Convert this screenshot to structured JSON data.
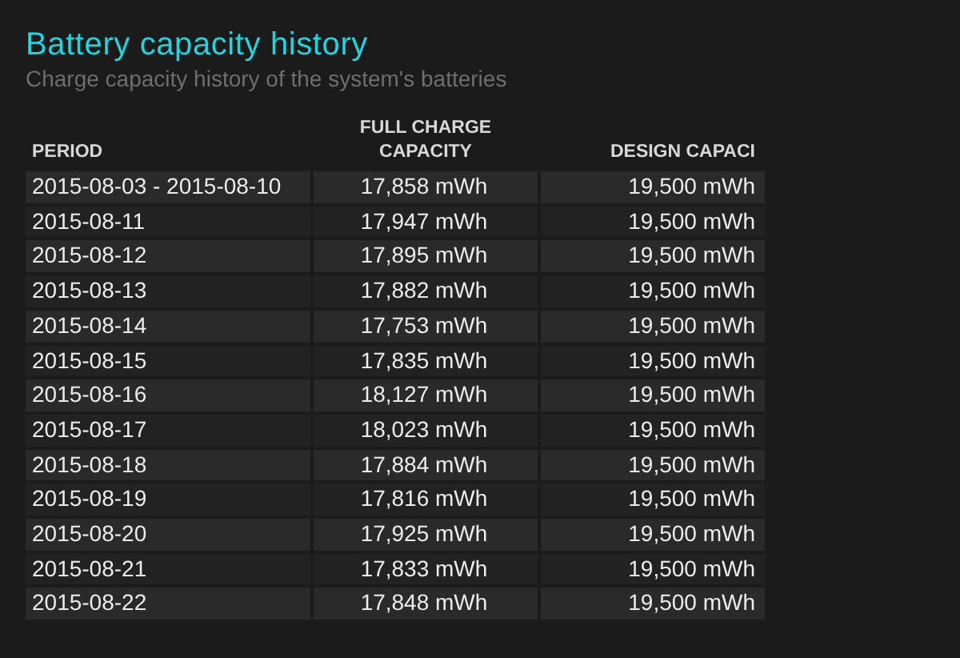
{
  "title": "Battery capacity history",
  "subtitle": "Charge capacity history of the system's batteries",
  "table": {
    "columns": [
      "PERIOD",
      "FULL CHARGE CAPACITY",
      "DESIGN CAPACI"
    ],
    "rows": [
      [
        "2015-08-03 - 2015-08-10",
        "17,858 mWh",
        "19,500 mWh"
      ],
      [
        "2015-08-11",
        "17,947 mWh",
        "19,500 mWh"
      ],
      [
        "2015-08-12",
        "17,895 mWh",
        "19,500 mWh"
      ],
      [
        "2015-08-13",
        "17,882 mWh",
        "19,500 mWh"
      ],
      [
        "2015-08-14",
        "17,753 mWh",
        "19,500 mWh"
      ],
      [
        "2015-08-15",
        "17,835 mWh",
        "19,500 mWh"
      ],
      [
        "2015-08-16",
        "18,127 mWh",
        "19,500 mWh"
      ],
      [
        "2015-08-17",
        "18,023 mWh",
        "19,500 mWh"
      ],
      [
        "2015-08-18",
        "17,884 mWh",
        "19,500 mWh"
      ],
      [
        "2015-08-19",
        "17,816 mWh",
        "19,500 mWh"
      ],
      [
        "2015-08-20",
        "17,925 mWh",
        "19,500 mWh"
      ],
      [
        "2015-08-21",
        "17,833 mWh",
        "19,500 mWh"
      ],
      [
        "2015-08-22",
        "17,848 mWh",
        "19,500 mWh"
      ]
    ]
  }
}
